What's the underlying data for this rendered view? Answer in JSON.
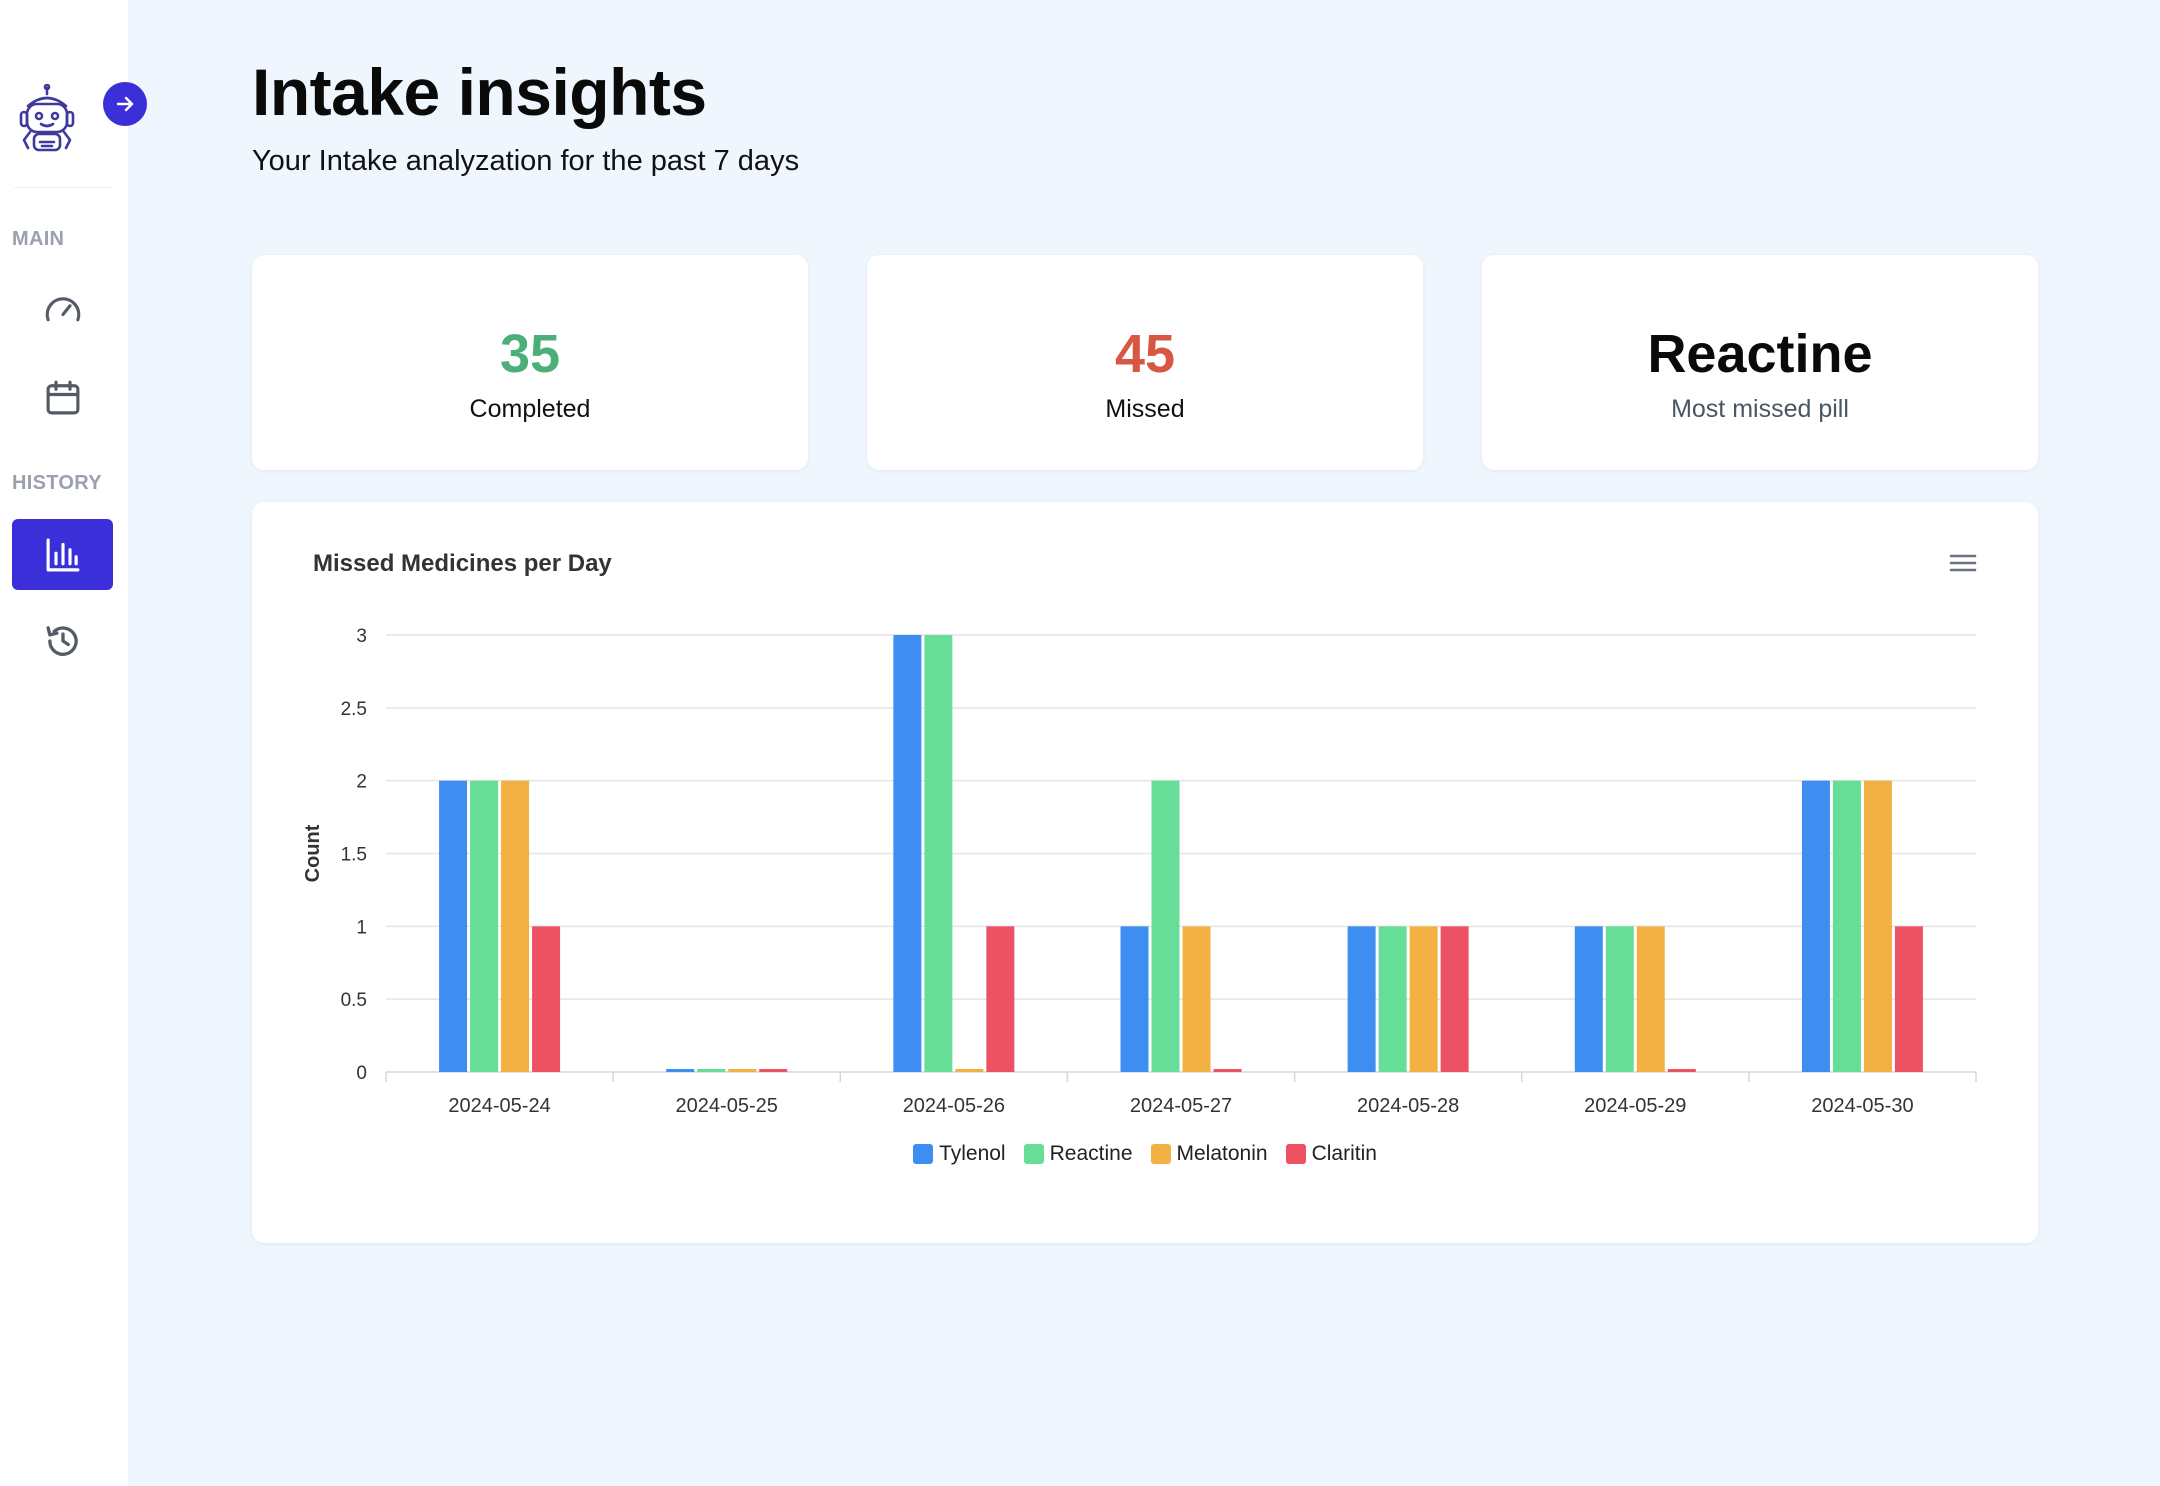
{
  "sidebar": {
    "sections": {
      "main": "MAIN",
      "history": "HISTORY"
    },
    "items": [
      {
        "icon": "gauge-icon"
      },
      {
        "icon": "calendar-icon"
      },
      {
        "icon": "bar-chart-icon",
        "active": true
      },
      {
        "icon": "history-icon"
      }
    ],
    "accent": "#3b2fd9"
  },
  "header": {
    "title": "Intake insights",
    "subtitle": "Your Intake analyzation for the past 7 days"
  },
  "stats": {
    "completed": {
      "value": "35",
      "label": "Completed",
      "color": "#4caf7a"
    },
    "missed": {
      "value": "45",
      "label": "Missed",
      "color": "#d65843"
    },
    "most_missed": {
      "value": "Reactine",
      "label": "Most missed pill"
    }
  },
  "chart_data": {
    "type": "bar",
    "title": "Missed Medicines per Day",
    "xlabel": "",
    "ylabel": "Count",
    "ylim": [
      0,
      3
    ],
    "yticks": [
      "0",
      "0.5",
      "1",
      "1.5",
      "2",
      "2.5",
      "3"
    ],
    "grid": true,
    "legend": "bottom-center",
    "categories": [
      "2024-05-24",
      "2024-05-25",
      "2024-05-26",
      "2024-05-27",
      "2024-05-28",
      "2024-05-29",
      "2024-05-30"
    ],
    "series": [
      {
        "name": "Tylenol",
        "color": "#3d8ef0",
        "values": [
          2,
          0,
          3,
          1,
          1,
          1,
          2
        ]
      },
      {
        "name": "Reactine",
        "color": "#67de98",
        "values": [
          2,
          0,
          3,
          2,
          1,
          1,
          2
        ]
      },
      {
        "name": "Melatonin",
        "color": "#f2b142",
        "values": [
          2,
          0,
          0,
          1,
          1,
          1,
          2
        ]
      },
      {
        "name": "Claritin",
        "color": "#ec5263",
        "values": [
          1,
          0,
          1,
          0,
          1,
          0,
          1
        ]
      }
    ]
  }
}
